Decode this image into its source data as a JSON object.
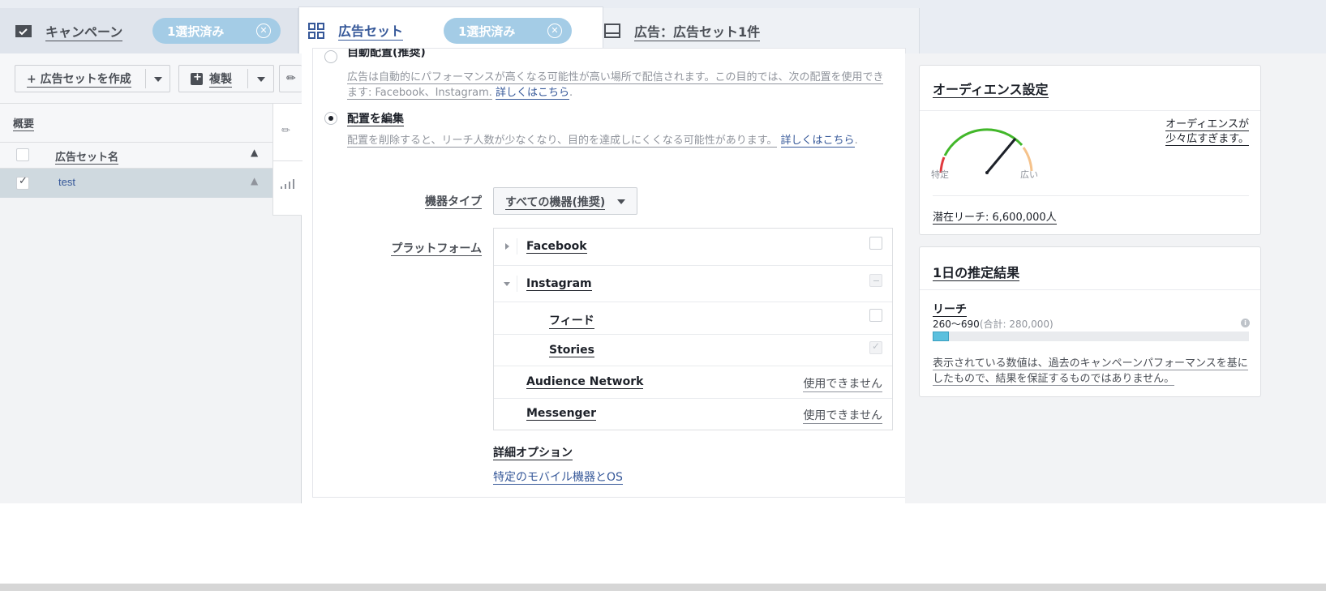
{
  "tabs": {
    "campaign": {
      "label": "キャンペーン",
      "selected": "1選択済み",
      "icon": "folder-icon"
    },
    "adset": {
      "label": "広告セット",
      "selected": "1選択済み",
      "icon": "grid-icon"
    },
    "ad": {
      "label": "広告：広告セット1件",
      "icon": "ad-icon"
    }
  },
  "toolbar": {
    "create_label": "+ 広告セットを作成",
    "duplicate_label": "複製"
  },
  "table": {
    "summary_label": "概要",
    "column_name": "広告セット名",
    "rows": [
      {
        "name": "test",
        "checked": true
      }
    ]
  },
  "placement": {
    "auto_title": "自動配置(推奨)",
    "auto_desc": "広告は自動的にパフォーマンスが高くなる可能性が高い場所で配信されます。この目的では、次の配置を使用できます: Facebook、Instagram.",
    "auto_link": "詳しくはこちら",
    "edit_title": "配置を編集",
    "edit_desc": "配置を削除すると、リーチ人数が少なくなり、目的を達成しにくくなる可能性があります。",
    "edit_link": "詳しくはこちら",
    "device_label": "機器タイプ",
    "device_value": "すべての機器(推奨)",
    "platform_label": "プラットフォーム",
    "platforms": {
      "facebook": "Facebook",
      "instagram": "Instagram",
      "feed": "フィード",
      "stories": "Stories",
      "audience_network": "Audience Network",
      "messenger": "Messenger",
      "unavailable": "使用できません"
    },
    "advanced_title": "詳細オプション",
    "advanced_link": "特定のモバイル機器とOS"
  },
  "audience": {
    "title": "オーディエンス設定",
    "gauge_left": "特定",
    "gauge_right": "広い",
    "status": "オーディエンスが少々広すぎます。",
    "reach_label": "潜在リーチ: 6,600,000人",
    "gauge_level": 0.72
  },
  "estimate": {
    "title": "1日の推定結果",
    "reach_title": "リーチ",
    "reach_range": "260〜690",
    "reach_total": "(合計: 280,000)",
    "bar_fraction": 0.05,
    "note": "表示されている数値は、過去のキャンペーンパフォーマンスを基にしたもので、結果を保証するものではありません。"
  },
  "colors": {
    "accent": "#365899",
    "pill": "#a4cce6",
    "gauge_red": "#e0393e",
    "gauge_green": "#42b72a",
    "gauge_orange": "#f5c28b",
    "reach_bar": "#5bc0de"
  }
}
